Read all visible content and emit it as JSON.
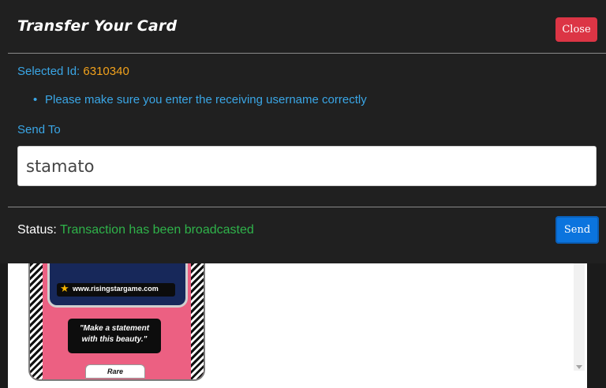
{
  "modal": {
    "title": "Transfer Your Card",
    "close_label": "Close",
    "selected_id_label": "Selected Id:",
    "selected_id_value": "6310340",
    "notice": "Please make sure you enter the receiving username correctly",
    "send_to_label": "Send To",
    "username_value": "stamato",
    "status_label": "Status:",
    "status_message": "Transaction has been broadcasted",
    "send_label": "Send"
  },
  "card": {
    "url": "www.risingstargame.com",
    "quote": "\"Make a statement with this beauty.\"",
    "rarity": "Rare"
  },
  "colors": {
    "label_blue": "#3aa6e6",
    "id_orange": "#f2a21c",
    "status_green": "#2fb34a",
    "close_red": "#dc3545",
    "send_blue": "#0b74de",
    "card_pink": "#ec6082"
  },
  "icons": [
    "star-icon",
    "scroll-down-arrow-icon"
  ]
}
